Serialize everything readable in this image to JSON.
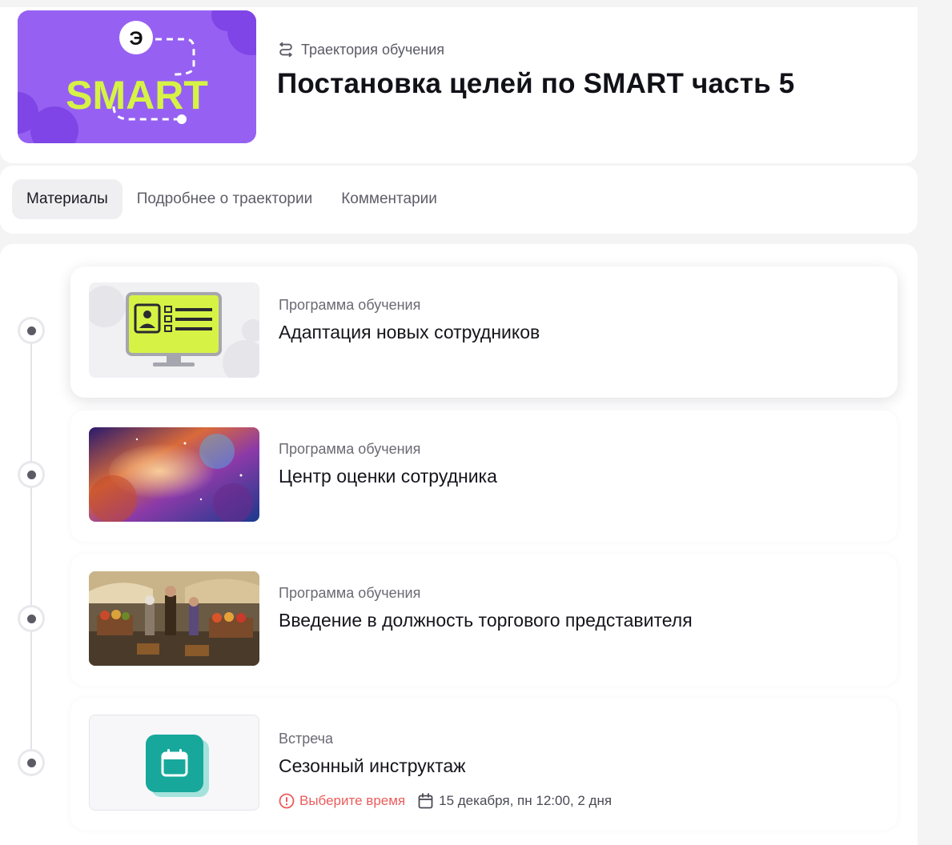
{
  "header": {
    "type_label": "Траектория обучения",
    "type_icon": "route-icon",
    "title": "Постановка целей по SMART часть 5",
    "cover": {
      "text": "SMART",
      "logo": "Э",
      "bg_color": "#9661f2",
      "text_color": "#d6f345"
    }
  },
  "tabs": [
    {
      "label": "Материалы",
      "active": true
    },
    {
      "label": "Подробнее о траектории",
      "active": false
    },
    {
      "label": "Комментарии",
      "active": false
    }
  ],
  "items": [
    {
      "type": "Программа обучения",
      "title": "Адаптация новых сотрудников",
      "thumb": "monitor-id-card-illustration"
    },
    {
      "type": "Программа обучения",
      "title": "Центр оценки сотрудника",
      "thumb": "nebula-image"
    },
    {
      "type": "Программа обучения",
      "title": "Введение в должность торгового представителя",
      "thumb": "market-scene-image"
    },
    {
      "type": "Встреча",
      "title": "Сезонный инструктаж",
      "thumb": "calendar-icon-tile",
      "warning": "Выберите время",
      "date": "15 декабря, пн 12:00, 2 дня"
    }
  ],
  "colors": {
    "accent_teal": "#17a89b",
    "warning": "#ec5b5b",
    "lime": "#d6f345"
  }
}
